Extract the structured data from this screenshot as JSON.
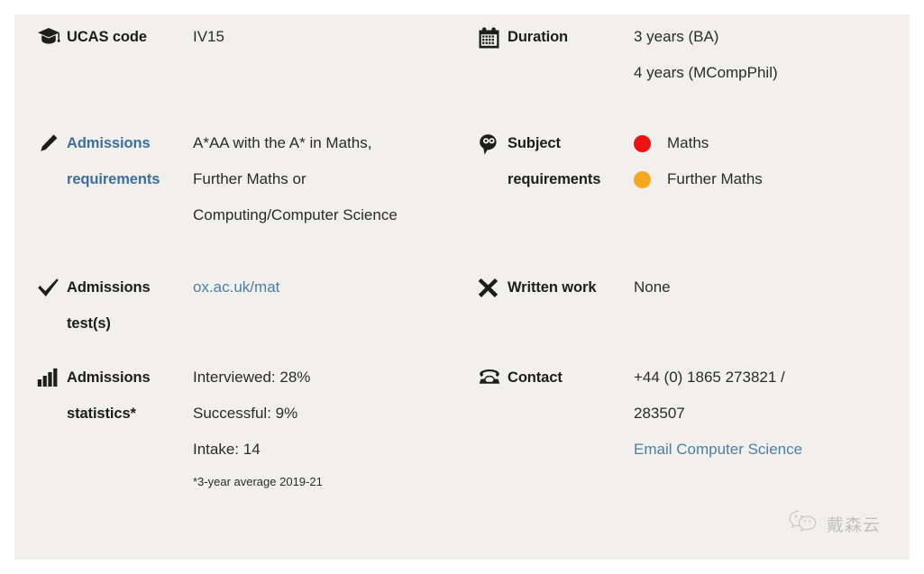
{
  "panel": {
    "background_color": "#f1f0ec",
    "page_background_color": "#ffffff"
  },
  "facts": [
    {
      "id": "ucas-code",
      "icon": "graduation-cap-icon",
      "label": "UCAS code",
      "label_is_link": false,
      "values": [
        "IV15"
      ]
    },
    {
      "id": "duration",
      "icon": "calendar-icon",
      "label": "Duration",
      "label_is_link": false,
      "values": [
        "3 years (BA)",
        "4 years (MCompPhil)"
      ]
    },
    {
      "id": "admissions-requirements",
      "icon": "pencil-icon",
      "label": "Admissions requirements",
      "label_is_link": true,
      "values": [
        "A*AA with the A* in Maths,",
        "Further Maths or",
        "Computing/Computer Science"
      ]
    },
    {
      "id": "subject-requirements",
      "icon": "head-brain-icon",
      "label": "Subject requirements",
      "label_is_link": false,
      "requirements": [
        {
          "name": "Maths",
          "color": "#ee1111"
        },
        {
          "name": "Further Maths",
          "color": "#f5a81c"
        }
      ]
    },
    {
      "id": "admissions-tests",
      "icon": "check-mark-icon",
      "label": "Admissions test(s)",
      "label_is_link": false,
      "values": [
        "ox.ac.uk/mat"
      ],
      "value_is_link": true
    },
    {
      "id": "written-work",
      "icon": "cross-x-icon",
      "label": "Written work",
      "label_is_link": false,
      "values": [
        "None"
      ]
    },
    {
      "id": "admissions-statistics",
      "icon": "bar-chart-icon",
      "label": "Admissions statistics*",
      "label_is_link": false,
      "values": [
        "Interviewed: 28%",
        "Successful: 9%",
        "Intake: 14"
      ],
      "note": "*3-year average 2019-21"
    },
    {
      "id": "contact",
      "icon": "telephone-icon",
      "label": "Contact",
      "label_is_link": false,
      "values": [
        "+44 (0) 1865 273821 /",
        "283507"
      ],
      "link_value": "Email Computer Science"
    }
  ],
  "fields": {
    "ucas_code_label": "UCAS code",
    "ucas_code_value": "IV15",
    "duration_label": "Duration",
    "duration_value_1": "3 years (BA)",
    "duration_value_2": "4 years (MCompPhil)",
    "admissions_requirements_label_1": "Admissions",
    "admissions_requirements_label_2": "requirements",
    "admissions_requirements_value_1": "A*AA with the A* in Maths,",
    "admissions_requirements_value_2": "Further Maths or",
    "admissions_requirements_value_3": "Computing/Computer Science",
    "subject_requirements_label_1": "Subject",
    "subject_requirements_label_2": "requirements",
    "subject_requirement_1": "Maths",
    "subject_requirement_2": "Further Maths",
    "admissions_tests_label_1": "Admissions",
    "admissions_tests_label_2": "test(s)",
    "admissions_tests_value": "ox.ac.uk/mat",
    "written_work_label": "Written work",
    "written_work_value": "None",
    "admissions_statistics_label_1": "Admissions",
    "admissions_statistics_label_2": "statistics*",
    "admissions_statistics_value_1": "Interviewed: 28%",
    "admissions_statistics_value_2": "Successful: 9%",
    "admissions_statistics_value_3": "Intake: 14",
    "admissions_statistics_note": "*3-year average 2019-21",
    "contact_label": "Contact",
    "contact_value_1": "+44 (0) 1865 273821 /",
    "contact_value_2": "283507",
    "contact_email_link": "Email Computer Science"
  },
  "colors": {
    "maths_dot": "#ee1111",
    "further_maths_dot": "#f5a81c",
    "link": "#3e6e9e",
    "value_link": "#4a7fa8",
    "text": "#1d1d1b"
  },
  "watermark": {
    "icon": "wechat-icon",
    "text": "戴森云"
  }
}
